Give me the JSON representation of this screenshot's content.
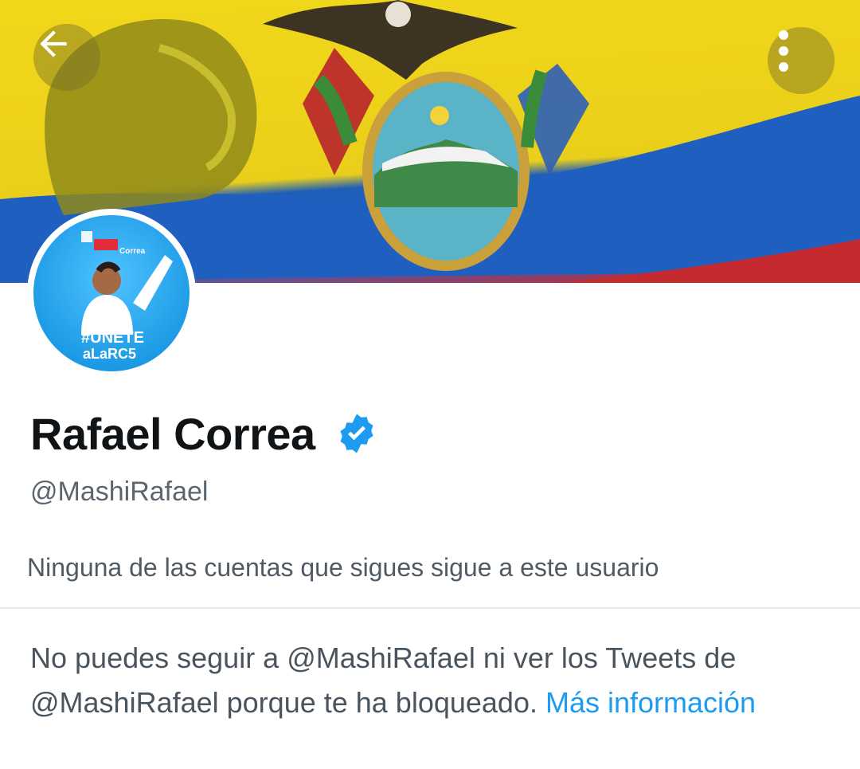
{
  "profile": {
    "name": "Rafael Correa",
    "handle": "@MashiRafael",
    "followers_note": "Ninguna de las cuentas que sigues sigue a este usuario",
    "blocked_message": "No puedes seguir a @MashiRafael ni ver los Tweets de @MashiRafael porque te ha bloqueado. ",
    "more_info_link": "Más información",
    "avatar_text_1": "#UNETE",
    "avatar_text_2": "aLaRC5",
    "avatar_badge": "Correa"
  },
  "icons": {
    "back": "arrow-left-icon",
    "more": "more-vertical-icon",
    "verified": "verified-badge-icon"
  },
  "colors": {
    "accent": "#1d9bf0",
    "text_primary": "#111417",
    "text_secondary": "#5b6670"
  }
}
